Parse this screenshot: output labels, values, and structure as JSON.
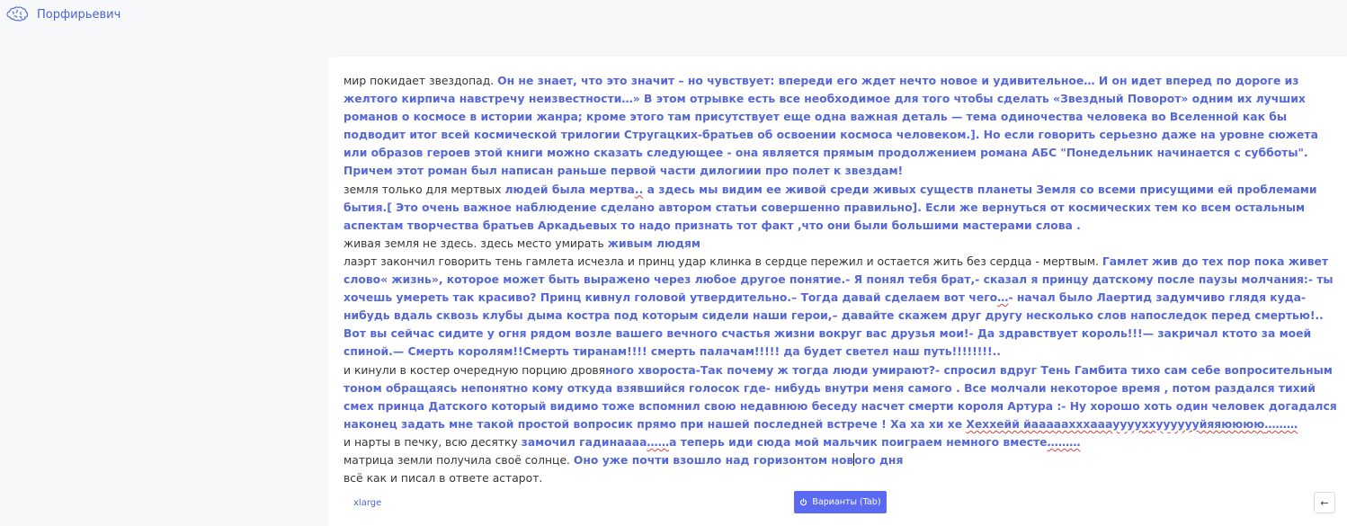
{
  "app": {
    "title": "Порфирьевич"
  },
  "paragraphs": [
    [
      {
        "t": "мир покидает звездопад. ",
        "g": false
      },
      {
        "t": "Он не знает, что это значит – но чувствует: впереди его ждет нечто новое и удивительное… И он идет вперед по дороге из желтого кирпича навстречу неизвестности…» В этом отрывке есть все необходимое для того чтобы сделать «Звездный Поворот» одним их лучших романов о космосе в истории жанра; кроме этого там присутствует еще одна важная деталь — тема одиночества человека во Вселенной как бы подводит итог всей космической трилогии Стругацких-братьев об освоении космоса человеком.]. Но если говорить серьезно даже на уровне сюжета или образов героев этой книги можно сказать следующее - она является прямым продолжением романа АБС \"Понедельник начинается с субботы\". Причем этот роман был написан раньше первой части дилогиии про полет к звездам!",
        "g": true
      }
    ],
    [
      {
        "t": "земля только для мертвых ",
        "g": false
      },
      {
        "t": "людей была мертва",
        "g": true
      },
      {
        "t": "..",
        "g": true,
        "s": true
      },
      {
        "t": " а здесь мы видим ее живой среди живых существ планеты Земля со всеми присущими ей проблемами бытия.[ Это очень важное наблюдение сделано автором статьи совершенно правильно]. Если же вернуться от космических тем ко всем остальным аспектам творчества братьев Аркадьевых то надо признать тот факт ,что они были большими мастерами слова .",
        "g": true
      }
    ],
    [
      {
        "t": "живая земля не здесь. здесь место умирать ",
        "g": false
      },
      {
        "t": "живым людям",
        "g": true
      }
    ],
    [
      {
        "t": "лаэрт закончил говорить тень гамлета исчезла и принц удар клинка в сердце пережил и остается жить без сердца - мертвым. ",
        "g": false
      },
      {
        "t": "Гамлет жив до тех пор пока живет слово« жизнь», которое может быть выражено через любое другое понятие.- Я понял тебя брат,- сказал я принцу датскому после паузы молчания:- ты хочешь умереть так красиво? Принц кивнул головой утвердительно.– Тогда давай сделаем вот чего",
        "g": true
      },
      {
        "t": "…",
        "g": true,
        "s": true
      },
      {
        "t": "- начал было Лаертид задумчиво глядя куда-нибудь вдаль сквозь клубы дыма костра под которым сидели наши герои,– давайте скажем друг другу несколько слов напоследок перед смертью!.. Вот вы сейчас сидите у огня рядом возле вашего вечного счастья жизни вокруг вас друзья мои!- Да здравствует король!!!— закричал ктото за моей спиной.— Смерть королям!!Смерть тиранам!!!! смерть палачам!!!!! да будет светел наш путь!!!!!!!!..",
        "g": true
      }
    ],
    [
      {
        "t": "и кинули в костер очередную порцию дровя",
        "g": false
      },
      {
        "t": "ного хвороста-Так почему ж тогда люди умирают?- спросил вдруг Тень Гамбита тихо сам себе вопросительным тоном обращаясь непонятно кому откуда взявшийся голосок где- нибудь внутри меня самого . Все молчали некоторое время , потом раздался тихий смех принца Датского который видимо тоже вспомнил свою недавнюю беседу насчет смерти короля Артура :- Ну хорошо хоть один человек догадался наконец задать мне такой простой вопросик прямо при нашей последней встрече ! Ха ха хи хе ",
        "g": true
      },
      {
        "t": "Хеххейй йааааахххаааууууххууууууйяяюююю",
        "g": true,
        "s": true
      },
      {
        "t": "………",
        "g": true,
        "s": true
      }
    ],
    [
      {
        "t": "и нарты в печку, всю десятку ",
        "g": false
      },
      {
        "t": "замочил гадинаааа",
        "g": true
      },
      {
        "t": "……",
        "g": true,
        "s": true
      },
      {
        "t": "а теперь иди сюда мой мальчик поиграем немного вместе",
        "g": true
      },
      {
        "t": "………",
        "g": true,
        "s": true
      }
    ],
    [
      {
        "t": "матрица земли получила своё солнце. ",
        "g": false
      },
      {
        "t": "Оно уже почти взошло над горизонтом нов",
        "g": true
      },
      {
        "caret": true
      },
      {
        "t": "ого дня",
        "g": true
      }
    ],
    [
      {
        "t": "всё как и писал в ответе астарот.",
        "g": false
      }
    ]
  ],
  "controls": {
    "model_label": "xlarge",
    "variants_label": "Варианты (Tab)",
    "back_glyph": "←"
  },
  "icons": {
    "logo": "brain-icon",
    "variants": "power-icon",
    "back": "arrow-left-icon"
  },
  "colors": {
    "generated_text": "#5568d6",
    "accent": "#5b6af2",
    "spell_error": "#d94141"
  }
}
